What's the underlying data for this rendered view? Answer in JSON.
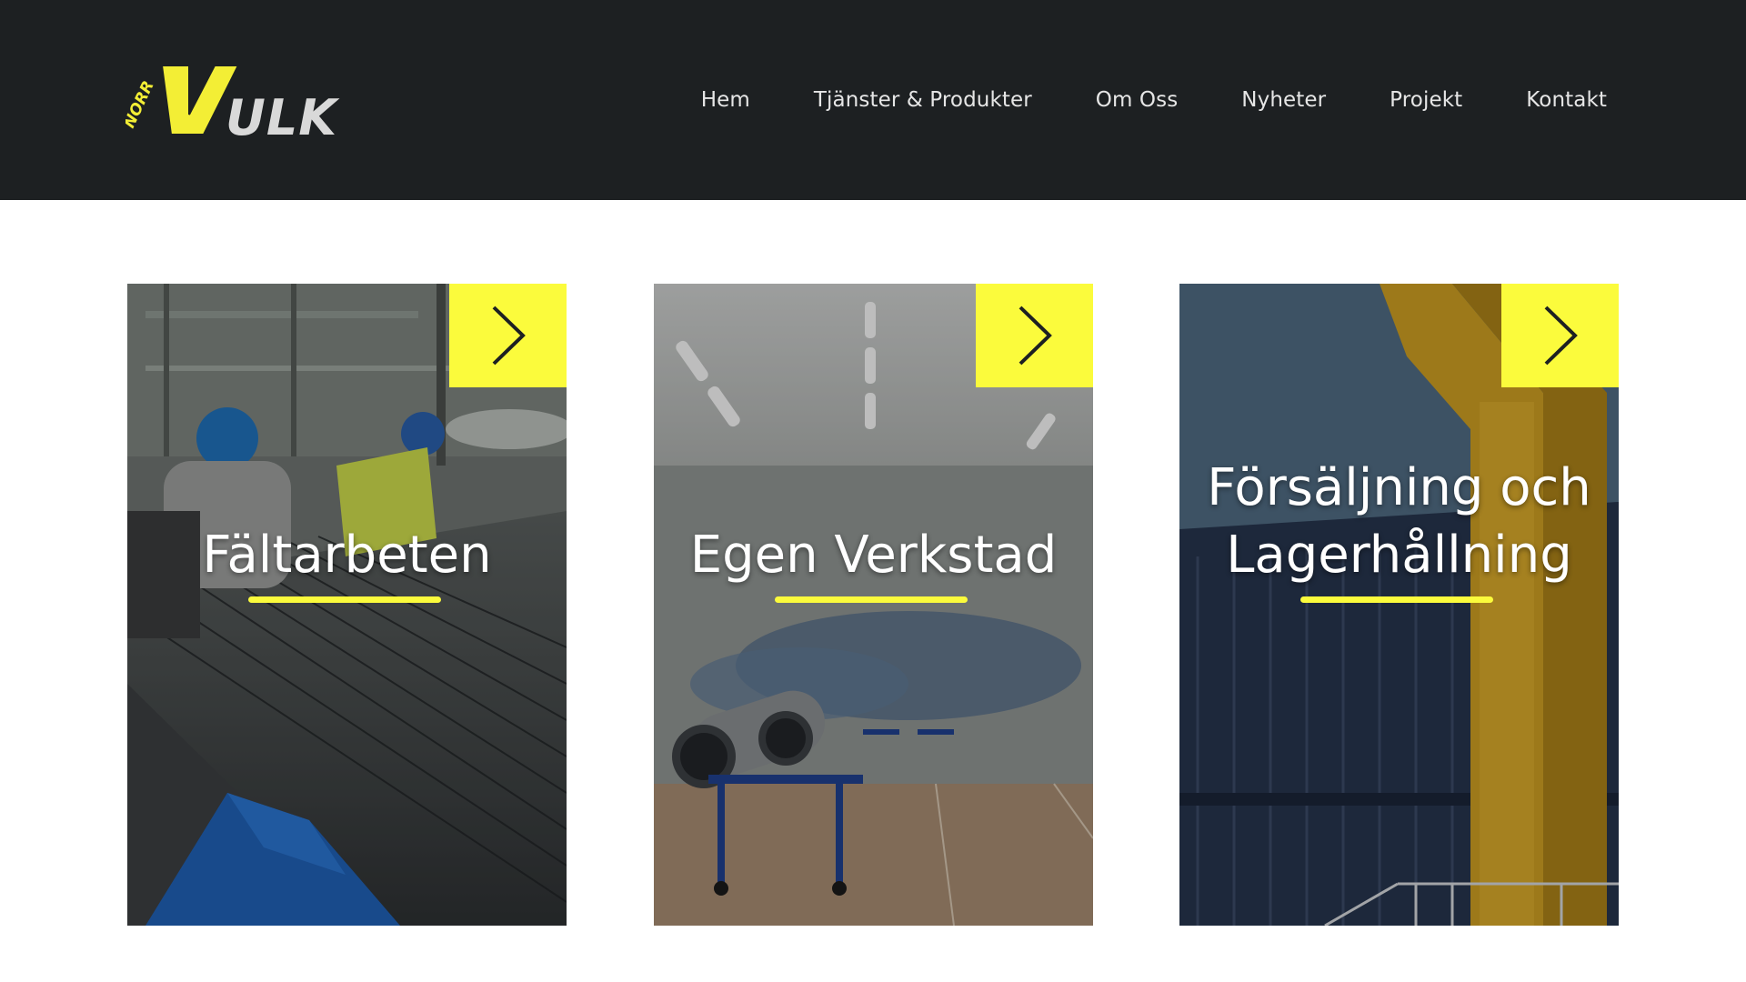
{
  "brand": {
    "logo_small": "NORR",
    "logo_main": "VULK",
    "accent_color": "#fbfb3c",
    "header_color": "#1d2022"
  },
  "nav": {
    "items": [
      {
        "label": "Hem"
      },
      {
        "label": "Tjänster & Produkter"
      },
      {
        "label": "Om Oss"
      },
      {
        "label": "Nyheter"
      },
      {
        "label": "Projekt"
      },
      {
        "label": "Kontakt"
      }
    ]
  },
  "cards": [
    {
      "title_lines": [
        "Fältarbeten"
      ],
      "arrow_icon": "chevron-right-icon"
    },
    {
      "title_lines": [
        "Egen Verkstad"
      ],
      "arrow_icon": "chevron-right-icon"
    },
    {
      "title_lines": [
        "Försäljning och",
        "Lagerhållning"
      ],
      "arrow_icon": "chevron-right-icon"
    }
  ]
}
